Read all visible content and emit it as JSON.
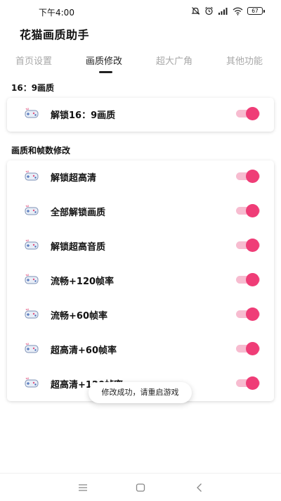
{
  "status_bar": {
    "time": "下午4:00",
    "battery": "67",
    "icons": [
      "mute-icon",
      "alarm-icon",
      "signal-icon",
      "wifi-icon",
      "battery-icon"
    ]
  },
  "app": {
    "title": "花猫画质助手"
  },
  "tabs": [
    {
      "label": "首页设置",
      "active": false
    },
    {
      "label": "画质修改",
      "active": true
    },
    {
      "label": "超大广角",
      "active": false
    },
    {
      "label": "其他功能",
      "active": false
    }
  ],
  "sections": [
    {
      "title": "16：9画质",
      "items": [
        {
          "label": "解锁16：9画质",
          "enabled": true
        }
      ]
    },
    {
      "title": "画质和帧数修改",
      "items": [
        {
          "label": "解锁超高清",
          "enabled": true
        },
        {
          "label": "全部解锁画质",
          "enabled": true
        },
        {
          "label": "解锁超高音质",
          "enabled": true
        },
        {
          "label": "流畅+120帧率",
          "enabled": true
        },
        {
          "label": "流畅+60帧率",
          "enabled": true
        },
        {
          "label": "超高清+60帧率",
          "enabled": true
        },
        {
          "label": "超高清+120帧率",
          "enabled": true
        }
      ]
    }
  ],
  "toast": {
    "message": "修改成功，请重启游戏"
  },
  "nav": [
    "menu-icon",
    "home-icon",
    "back-icon"
  ],
  "colors": {
    "accent": "#ef3d77",
    "accent_track": "#f7bcd0",
    "inactive_tab": "#a8a8a8"
  }
}
